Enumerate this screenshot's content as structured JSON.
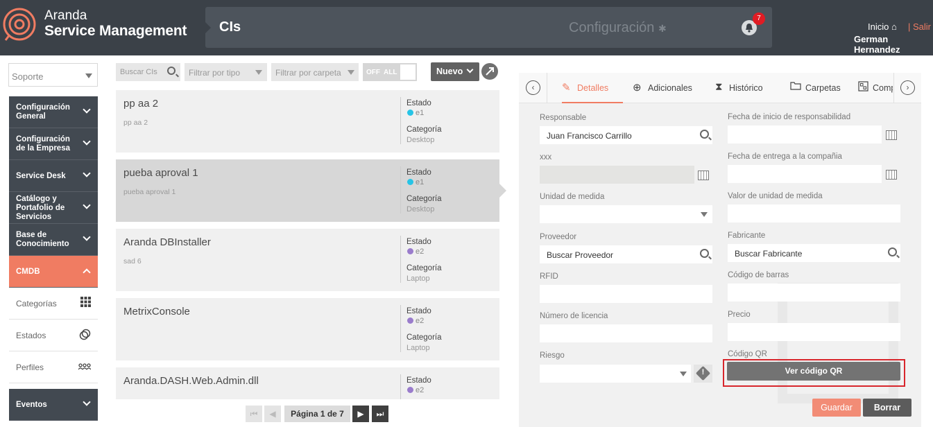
{
  "header": {
    "brand_line1": "Aranda",
    "brand_line2": "Service Management",
    "section_title": "CIs",
    "config_label": "Configuración",
    "notifications_count": "7",
    "inicio": "Inicio",
    "salir": "| Salir",
    "user_name": "German Hernandez"
  },
  "sidebar": {
    "project": "Soporte",
    "menu": [
      {
        "label": "Configuración General"
      },
      {
        "label": "Configuración de la Empresa"
      },
      {
        "label": "Service Desk"
      },
      {
        "label": "Catálogo y Portafolio de Servicios"
      },
      {
        "label": "Base de Conocimiento"
      },
      {
        "label": "CMDB"
      }
    ],
    "cmdb_items": [
      {
        "label": "Categorías",
        "icon": "grid-icon"
      },
      {
        "label": "Estados",
        "icon": "states-icon"
      },
      {
        "label": "Perfiles",
        "icon": "profiles-icon"
      }
    ],
    "eventos": "Eventos"
  },
  "filters": {
    "search_placeholder": "Buscar CIs",
    "type_placeholder": "Filtrar por tipo",
    "folder_placeholder": "Filtrar por carpeta",
    "toggle_off": "OFF",
    "toggle_all": "ALL",
    "new_button": "Nuevo"
  },
  "list": {
    "estado_label": "Estado",
    "categoria_label": "Categoría",
    "items": [
      {
        "name": "pp aa 2",
        "desc": "pp aa 2",
        "estado": "e1",
        "estado_color": "#27c4e6",
        "categoria": "Desktop"
      },
      {
        "name": "pueba aproval 1",
        "desc": "pueba aproval 1",
        "estado": "e1",
        "estado_color": "#27c4e6",
        "categoria": "Desktop"
      },
      {
        "name": "Aranda DBInstaller",
        "desc": "sad 6",
        "estado": "e2",
        "estado_color": "#9a7ccc",
        "categoria": "Laptop"
      },
      {
        "name": "MetrixConsole",
        "desc": "",
        "estado": "e2",
        "estado_color": "#9a7ccc",
        "categoria": "Laptop"
      },
      {
        "name": "Aranda.DASH.Web.Admin.dll",
        "desc": "",
        "estado": "e2",
        "estado_color": "#9a7ccc",
        "categoria": ""
      }
    ],
    "pagination": "Página 1 de 7"
  },
  "detail": {
    "tabs": [
      "Detalles",
      "Adicionales",
      "Histórico",
      "Carpetas",
      "Comp"
    ],
    "labels": {
      "responsable": "Responsable",
      "fecha_inicio": "Fecha de inicio de responsabilidad",
      "xxx": "xxx",
      "fecha_entrega": "Fecha de entrega a la compañia",
      "unidad": "Unidad de medida",
      "valor_unidad": "Valor de unidad de medida",
      "proveedor": "Proveedor",
      "fabricante": "Fabricante",
      "rfid": "RFID",
      "codigo_barras": "Código de barras",
      "licencia": "Número de licencia",
      "precio": "Precio",
      "riesgo": "Riesgo",
      "codigo_qr": "Código QR"
    },
    "values": {
      "responsable": "Juan Francisco Carrillo",
      "proveedor": "Buscar Proveedor",
      "fabricante": "Buscar Fabricante"
    },
    "qr_button": "Ver código QR",
    "save_button": "Guardar",
    "delete_button": "Borrar"
  }
}
